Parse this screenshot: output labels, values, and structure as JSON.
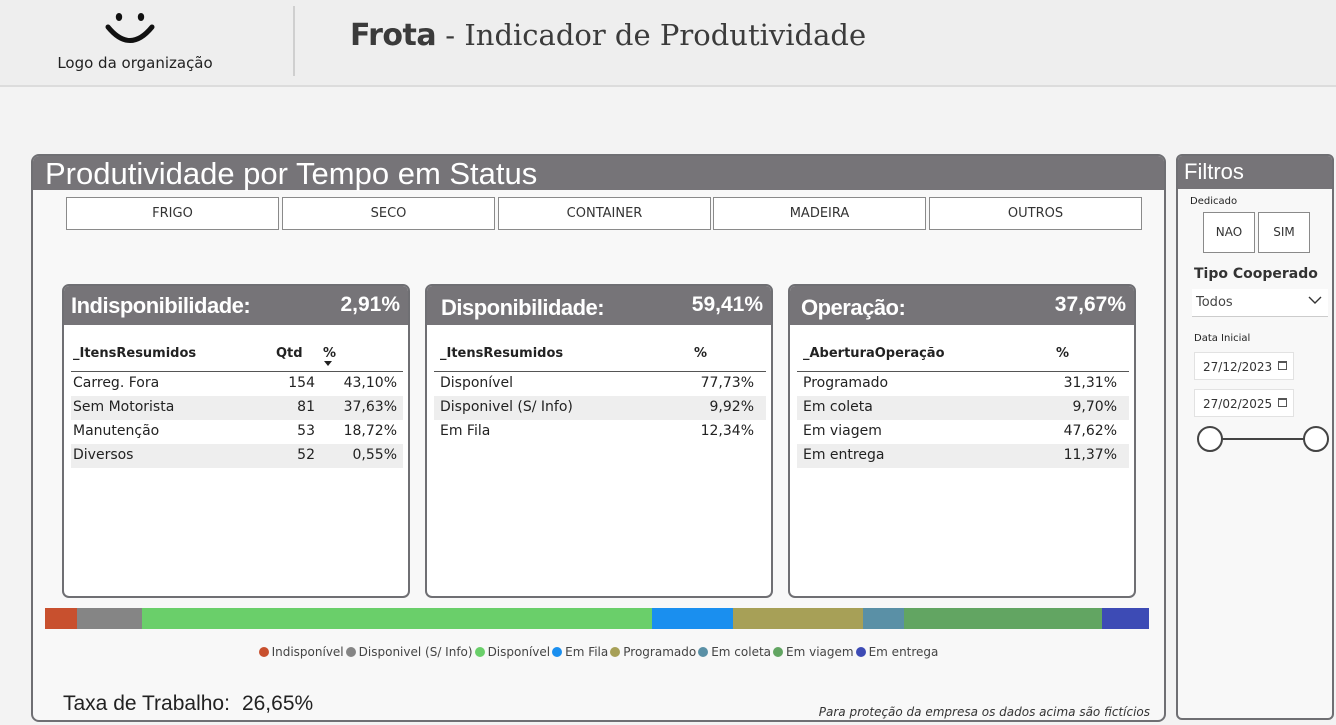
{
  "header": {
    "logo_caption": "Logo da organização",
    "title_bold": "Frota",
    "title_rest": " - Indicador de Produtividade"
  },
  "main": {
    "title": "Produtividade por Tempo em Status",
    "segments": [
      "FRIGO",
      "SECO",
      "CONTAINER",
      "MADEIRA",
      "OUTROS"
    ],
    "cards": [
      {
        "label": "Indisponibilidade:",
        "value": "2,91%",
        "columns": [
          "_ItensResumidos",
          "Qtd",
          "%"
        ],
        "rows": [
          {
            "item": "Carreg. Fora",
            "qtd": "154",
            "pct": "43,10%"
          },
          {
            "item": "Sem Motorista",
            "qtd": "81",
            "pct": "37,63%"
          },
          {
            "item": "Manutenção",
            "qtd": "53",
            "pct": "18,72%"
          },
          {
            "item": "Diversos",
            "qtd": "52",
            "pct": "0,55%"
          }
        ]
      },
      {
        "label": "Disponibilidade:",
        "value": "59,41%",
        "columns": [
          "_ItensResumidos",
          "%"
        ],
        "rows": [
          {
            "item": "Disponível",
            "pct": "77,73%"
          },
          {
            "item": "Disponivel (S/ Info)",
            "pct": "9,92%"
          },
          {
            "item": "Em Fila",
            "pct": "12,34%"
          }
        ]
      },
      {
        "label": "Operação:",
        "value": "37,67%",
        "columns": [
          "_AberturaOperação",
          "%"
        ],
        "rows": [
          {
            "item": "Programado",
            "pct": "31,31%"
          },
          {
            "item": "Em coleta",
            "pct": "9,70%"
          },
          {
            "item": "Em viagem",
            "pct": "47,62%"
          },
          {
            "item": "Em entrega",
            "pct": "11,37%"
          }
        ]
      }
    ],
    "status_bar": [
      {
        "name": "Indisponível",
        "share": 2.91,
        "color": "#c8502e"
      },
      {
        "name": "Disponivel (S/ Info)",
        "share": 5.89,
        "color": "#858585"
      },
      {
        "name": "Disponível",
        "share": 46.18,
        "color": "#6acf6a"
      },
      {
        "name": "Em Fila",
        "share": 7.33,
        "color": "#1a8fef"
      },
      {
        "name": "Programado",
        "share": 11.79,
        "color": "#a7a057"
      },
      {
        "name": "Em coleta",
        "share": 3.65,
        "color": "#5a90a6"
      },
      {
        "name": "Em viagem",
        "share": 17.94,
        "color": "#62a562"
      },
      {
        "name": "Em entrega",
        "share": 4.28,
        "color": "#3d4bb5"
      }
    ],
    "work_rate_label": "Taxa de Trabalho:",
    "work_rate_value": "26,65%",
    "disclaimer": "Para proteção da empresa os dados acima são fictícios"
  },
  "filters": {
    "title": "Filtros",
    "dedicado_label": "Dedicado",
    "dedicado_options": [
      "NAO",
      "SIM"
    ],
    "tipo_label": "Tipo Cooperado",
    "tipo_value": "Todos",
    "data_label": "Data Inicial",
    "date_start": "27/12/2023",
    "date_end": "27/02/2025"
  }
}
